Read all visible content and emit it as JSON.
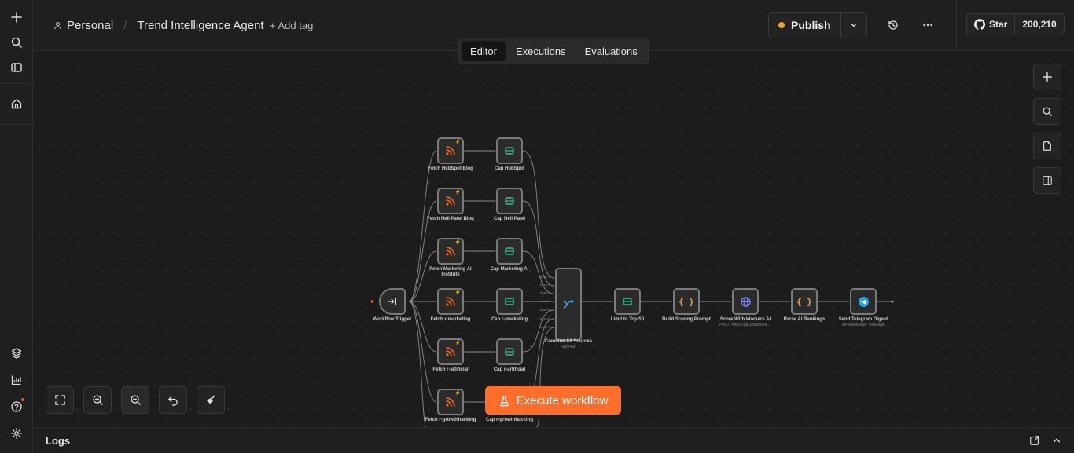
{
  "header": {
    "project": "Personal",
    "workflow_name": "Trend Intelligence Agent",
    "add_tag": "+ Add tag",
    "publish_label": "Publish",
    "star_label": "Star",
    "star_count": "200,210"
  },
  "tabs": [
    {
      "label": "Editor",
      "active": true
    },
    {
      "label": "Executions",
      "active": false
    },
    {
      "label": "Evaluations",
      "active": false
    }
  ],
  "nodes": {
    "trigger": {
      "label": "Workflow Trigger"
    },
    "fetch": [
      {
        "label": "Fetch HubSpot Blog"
      },
      {
        "label": "Fetch Neil Patel Blog"
      },
      {
        "label": "Fetch Marketing AI Institute"
      },
      {
        "label": "Fetch r-marketing"
      },
      {
        "label": "Fetch r-artificial"
      },
      {
        "label": "Fetch r-growthhacking"
      }
    ],
    "cap": [
      {
        "label": "Cap HubSpot"
      },
      {
        "label": "Cap Neil Patel"
      },
      {
        "label": "Cap Marketing AI"
      },
      {
        "label": "Cap r-marketing"
      },
      {
        "label": "Cap r-artificial"
      },
      {
        "label": "Cap r-growthhacking"
      }
    ],
    "merge": {
      "label": "Combine All Sources",
      "sub": "append",
      "inputs": [
        "Input 1",
        "Input 2",
        "Input 3",
        "Input 4",
        "Input 5",
        "Input 6",
        "Input 7"
      ]
    },
    "limit": {
      "label": "Limit to Top 50"
    },
    "build": {
      "label": "Build Scoring Prompt"
    },
    "score": {
      "label": "Score With Workers AI",
      "sub": "POST: https://api.cloudflare...."
    },
    "parse": {
      "label": "Parse AI Rankings"
    },
    "telegram": {
      "label": "Send Telegram Digest",
      "sub": "sendMessage: message"
    }
  },
  "execute_label": "Execute workflow",
  "logs_label": "Logs",
  "colors": {
    "accent": "#ff6d2b",
    "rss": "#f26722",
    "cap": "#3fbf8e",
    "merge": "#3fa8d8",
    "code": "#f5a524",
    "http": "#7b8cf5",
    "telegram": "#2aa3df",
    "publish_dot": "#f5a524"
  }
}
